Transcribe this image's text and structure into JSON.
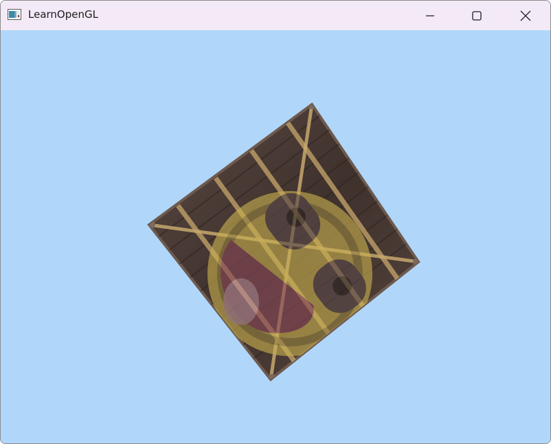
{
  "window": {
    "title": "LearnOpenGL",
    "clear_color": "#b0d7fa",
    "titlebar_color": "#f4eaf7"
  },
  "titlebar": {
    "app_icon": "window-app-icon",
    "controls": [
      {
        "name": "minimize",
        "icon": "minimize-icon"
      },
      {
        "name": "maximize",
        "icon": "maximize-icon"
      },
      {
        "name": "close",
        "icon": "close-icon"
      }
    ]
  },
  "scene": {
    "object": "textured-crate-quad",
    "texture_colors": {
      "wood_dark": "#4a3a33",
      "wood_plank": "#b99860",
      "smiley_yellow": "#c8b050",
      "smiley_face": "#8a5a62"
    }
  }
}
